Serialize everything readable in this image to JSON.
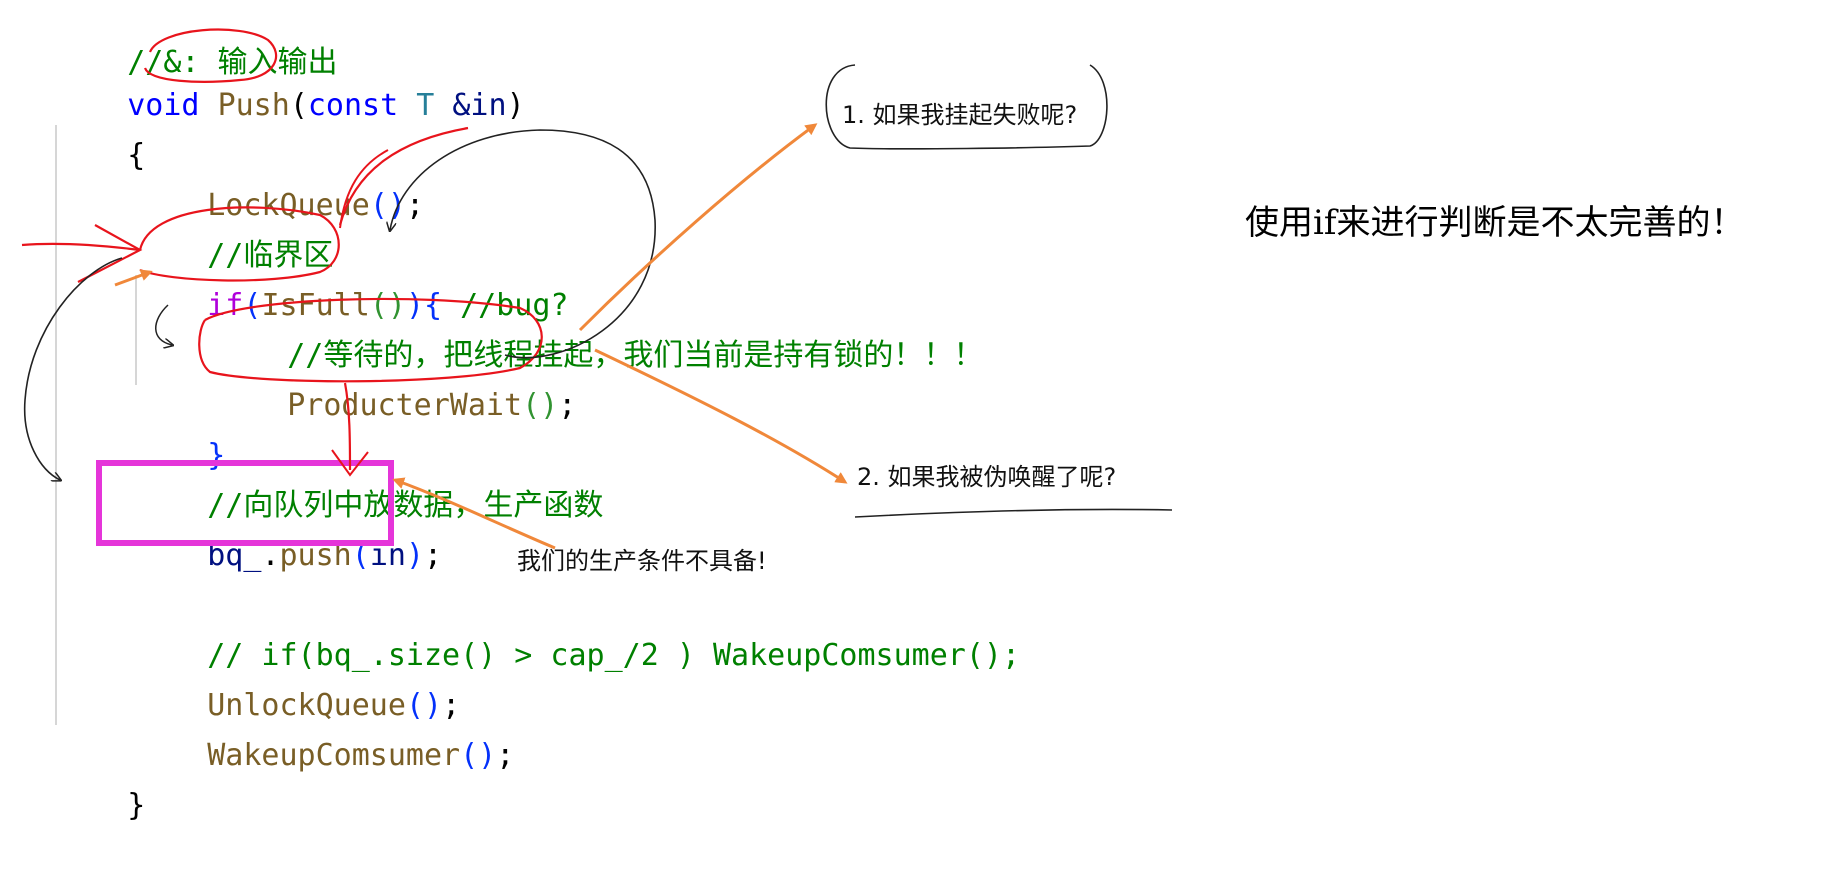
{
  "code": {
    "line1": {
      "comment": "//&: 输入输出"
    },
    "line2": {
      "kw_void": "void",
      "fn_push": "Push",
      "paren_open": "(",
      "kw_const": "const",
      "type_t": "T",
      "ref": "&in",
      "paren_close": ")"
    },
    "line3": {
      "brace": "{"
    },
    "line4": {
      "fn": "LockQueue",
      "parens": "()",
      "semi": ";"
    },
    "line5": {
      "comment": "//临界区"
    },
    "line6": {
      "kw_if": "if",
      "paren_open": "(",
      "fn": "IsFull",
      "inner_parens": "()",
      "paren_close": ")",
      "brace": "{",
      "comment": " //bug?"
    },
    "line7": {
      "comment": "//等待的，把线程挂起，我们当前是持有锁的！！！"
    },
    "line8": {
      "fn": "ProducterWait",
      "parens": "()",
      "semi": ";"
    },
    "line9": {
      "brace": "}"
    },
    "line10": {
      "comment": "//向队列中放数据，生产函数"
    },
    "line11": {
      "var": "bq_",
      "dot": ".",
      "fn": "push",
      "paren_open": "(",
      "arg": "in",
      "paren_close": ")",
      "semi": ";"
    },
    "line12": {
      "comment": "// if(bq_.size() > cap_/2 ) WakeupComsumer();"
    },
    "line13": {
      "fn": "UnlockQueue",
      "parens": "()",
      "semi": ";"
    },
    "line14": {
      "fn": "WakeupComsumer",
      "parens": "()",
      "semi": ";"
    },
    "line15": {
      "brace": "}"
    }
  },
  "annotations": {
    "question1": "1. 如果我挂起失败呢?",
    "question2": "2. 如果我被伪唤醒了呢?",
    "condition": "我们的生产条件不具备!",
    "side_note": "使用if来进行判断是不太完善的！"
  },
  "colors": {
    "keyword": "#0000ff",
    "function": "#795e26",
    "type": "#267f99",
    "variable": "#001080",
    "comment": "#008000",
    "ink_red": "#e8141c",
    "ink_orange": "#f0883a",
    "ink_black": "#222222",
    "highlight_box": "#e535d9"
  }
}
